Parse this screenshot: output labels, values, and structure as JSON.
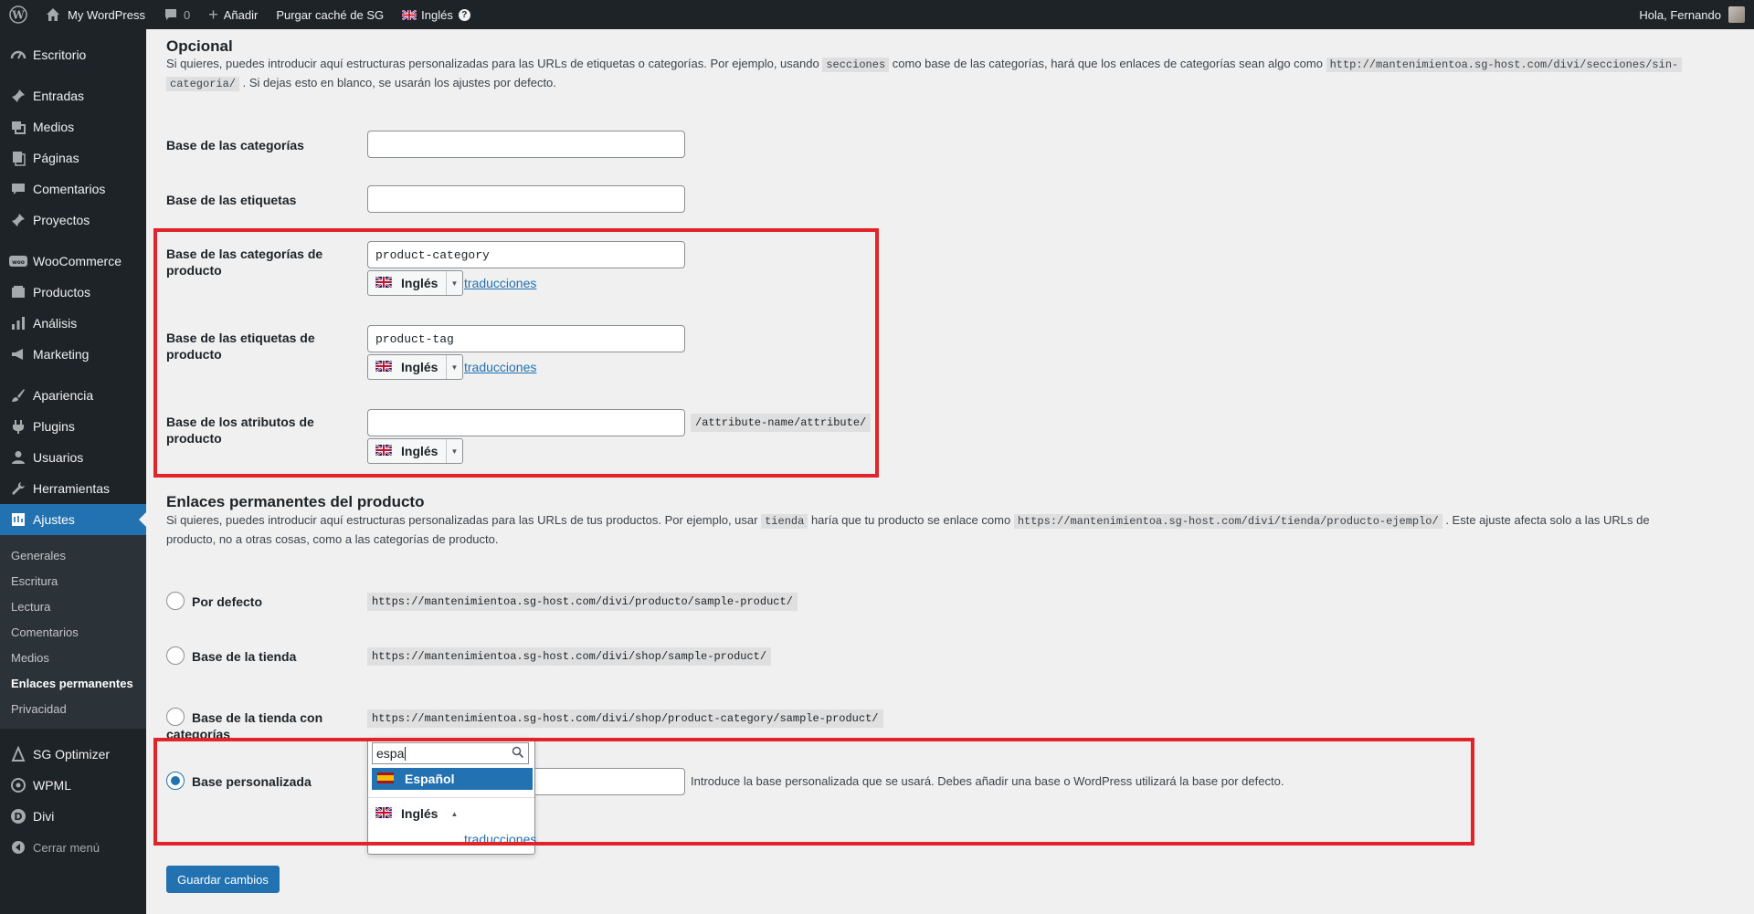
{
  "adminbar": {
    "site_name": "My WordPress",
    "comments_count": "0",
    "add_label": "Añadir",
    "purge_label": "Purgar caché de SG",
    "language_label": "Inglés",
    "greeting": "Hola, Fernando"
  },
  "sidebar": {
    "items": [
      {
        "label": "Escritorio",
        "icon": "dashboard-icon"
      },
      {
        "label": "Entradas",
        "icon": "pin-icon"
      },
      {
        "label": "Medios",
        "icon": "media-icon"
      },
      {
        "label": "Páginas",
        "icon": "pages-icon"
      },
      {
        "label": "Comentarios",
        "icon": "comments-icon"
      },
      {
        "label": "Proyectos",
        "icon": "pin-icon"
      },
      {
        "label": "WooCommerce",
        "icon": "woo-icon"
      },
      {
        "label": "Productos",
        "icon": "products-icon"
      },
      {
        "label": "Análisis",
        "icon": "analytics-icon"
      },
      {
        "label": "Marketing",
        "icon": "megaphone-icon"
      },
      {
        "label": "Apariencia",
        "icon": "brush-icon"
      },
      {
        "label": "Plugins",
        "icon": "plugin-icon"
      },
      {
        "label": "Usuarios",
        "icon": "users-icon"
      },
      {
        "label": "Herramientas",
        "icon": "wrench-icon"
      },
      {
        "label": "Ajustes",
        "icon": "settings-icon"
      }
    ],
    "submenu": [
      "Generales",
      "Escritura",
      "Lectura",
      "Comentarios",
      "Medios",
      "Enlaces permanentes",
      "Privacidad"
    ],
    "bottom": [
      {
        "label": "SG Optimizer",
        "icon": "sg-icon"
      },
      {
        "label": "WPML",
        "icon": "wpml-icon"
      },
      {
        "label": "Divi",
        "icon": "divi-icon"
      }
    ],
    "collapse_label": "Cerrar menú"
  },
  "optional": {
    "title": "Opcional",
    "desc_1": "Si quieres, puedes introducir aquí estructuras personalizadas para las URLs de etiquetas o categorías. Por ejemplo, usando",
    "desc_code_1": "secciones",
    "desc_2": "como base de las categorías, hará que los enlaces de categorías sean algo como",
    "desc_code_2a": "http://mantenimientoa.sg-host.com/divi/secciones/sin-",
    "desc_code_2b": "categoria/",
    "desc_3": ". Si dejas esto en blanco, se usarán los ajustes por defecto.",
    "category_base_label": "Base de las categorías",
    "category_base_value": "",
    "tag_base_label": "Base de las etiquetas",
    "tag_base_value": "",
    "product_cat_label_1": "Base de las categorías de",
    "product_cat_label_2": "producto",
    "product_cat_value": "product-category",
    "product_tag_label_1": "Base de las etiquetas de",
    "product_tag_label_2": "producto",
    "product_tag_value": "product-tag",
    "attr_label_1": "Base de los atributos de",
    "attr_label_2": "producto",
    "attr_value": "",
    "attr_suffix": "/attribute-name/attribute/",
    "language": "Inglés",
    "translations_link": "traducciones"
  },
  "product_permalinks": {
    "title": "Enlaces permanentes del producto",
    "desc_1": "Si quieres, puedes introducir aquí estructuras personalizadas para las URLs de tus productos. Por ejemplo, usar",
    "desc_code_1": "tienda",
    "desc_2": "haría que tu producto se enlace como",
    "desc_code_2": "https://mantenimientoa.sg-host.com/divi/tienda/producto-ejemplo/",
    "desc_3": ". Este ajuste afecta solo a las URLs de",
    "desc_4": "producto, no a otras cosas, como a las categorías de producto.",
    "options": [
      {
        "label": "Por defecto",
        "url": "https://mantenimientoa.sg-host.com/divi/producto/sample-product/",
        "checked": false
      },
      {
        "label": "Base de la tienda",
        "url": "https://mantenimientoa.sg-host.com/divi/shop/sample-product/",
        "checked": false
      },
      {
        "label_1": "Base de la tienda con",
        "label_2": "categorías",
        "url": "https://mantenimientoa.sg-host.com/divi/shop/product-category/sample-product/",
        "checked": false
      },
      {
        "label": "Base personalizada",
        "checked": true
      }
    ],
    "custom_value": "",
    "custom_help": "Introduce la base personalizada que se usará. Debes añadir una base o WordPress utilizará la base por defecto.",
    "dropdown_search": "espa",
    "dropdown_option": "Español",
    "language": "Inglés",
    "translations_link": "traducciones"
  },
  "save_button": "Guardar cambios",
  "colors": {
    "accent": "#2271b1",
    "highlight_box": "#e3232a",
    "sidebar_bg": "#1d2327"
  }
}
